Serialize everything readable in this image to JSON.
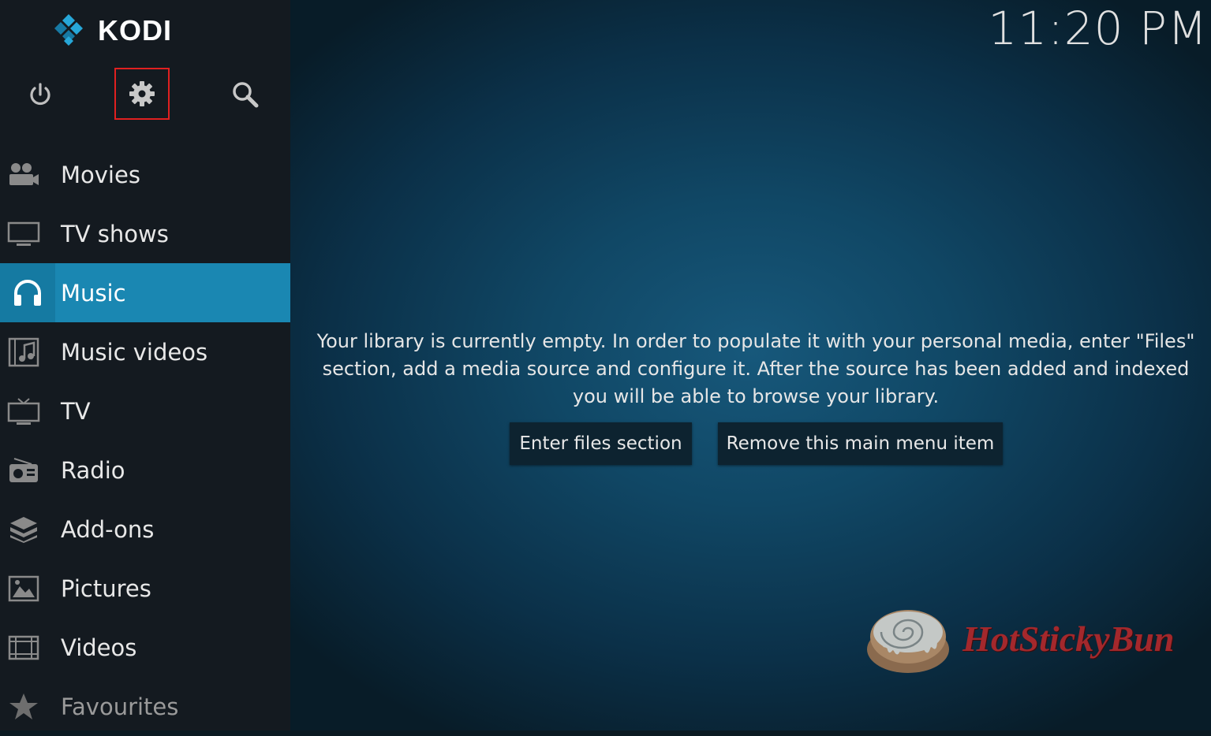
{
  "app": {
    "name": "KODI"
  },
  "clock": {
    "time": "11:20 PM"
  },
  "top_icons": {
    "power": "power-icon",
    "settings": "gear-icon",
    "search": "search-icon"
  },
  "menu": {
    "items": [
      {
        "label": "Movies",
        "icon": "movies-icon"
      },
      {
        "label": "TV shows",
        "icon": "tv-shows-icon"
      },
      {
        "label": "Music",
        "icon": "headphones-icon",
        "active": true
      },
      {
        "label": "Music videos",
        "icon": "music-videos-icon"
      },
      {
        "label": "TV",
        "icon": "tv-icon"
      },
      {
        "label": "Radio",
        "icon": "radio-icon"
      },
      {
        "label": "Add-ons",
        "icon": "addons-icon"
      },
      {
        "label": "Pictures",
        "icon": "pictures-icon"
      },
      {
        "label": "Videos",
        "icon": "videos-icon"
      },
      {
        "label": "Favourites",
        "icon": "star-icon"
      }
    ]
  },
  "main": {
    "message_line1": "Your library is currently empty. In order to populate it with your personal media, enter \"Files\"",
    "message_line2": "section, add a media source and configure it. After the source has been added and indexed",
    "message_line3": "you will be able to browse your library.",
    "enter_files_label": "Enter files section",
    "remove_item_label": "Remove this main menu item"
  },
  "watermark": {
    "text": "HotStickyBun"
  },
  "colors": {
    "sidebar_bg": "#141a20",
    "active_item": "#1a87b2",
    "highlight_border": "#e02020",
    "watermark_text": "#a3282c"
  }
}
